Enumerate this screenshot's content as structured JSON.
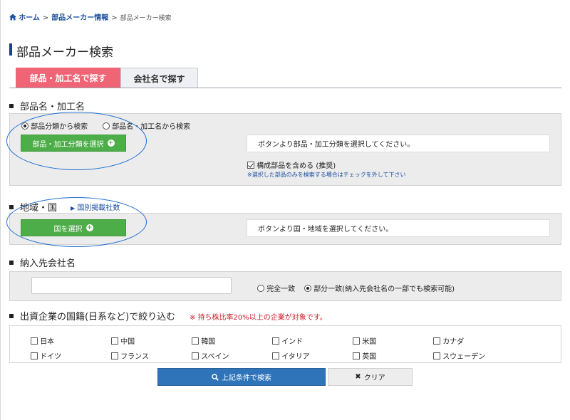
{
  "breadcrumb": {
    "home": "ホーム",
    "sep1": ">",
    "parts": "部品メーカー情報",
    "sep2": ">",
    "current": "部品メーカー検索"
  },
  "page_title": "部品メーカー検索",
  "tabs": [
    {
      "label": "部品・加工名で探す"
    },
    {
      "label": "会社名で探す"
    }
  ],
  "part_section": {
    "heading": "部品名・加工名",
    "radio_category": "部品分類から検索",
    "radio_name": "部品名・加工名から検索",
    "select_button": "部品・加工分類を選択",
    "info": "ボタンより部品・加工分類を選択してください。",
    "include_label": "構成部品を含める (推奨)",
    "include_note": "※選択した部品のみを検索する場合はチェックを外して下さい"
  },
  "region_section": {
    "heading": "地域・国",
    "link": "国別掲載社数",
    "select_button": "国を選択",
    "info": "ボタンより国・地域を選択してください。"
  },
  "customer_section": {
    "heading": "納入先会社名",
    "input_value": "",
    "radio_exact": "完全一致",
    "radio_partial": "部分一致(納入先会社名の一部でも検索可能)"
  },
  "nationality_section": {
    "heading": "出資企業の国籍(日系など)で絞り込む",
    "note": "※ 持ち株比率20%以上の企業が対象です。",
    "countries": [
      "日本",
      "中国",
      "韓国",
      "インド",
      "米国",
      "カナダ",
      "ドイツ",
      "フランス",
      "スペイン",
      "イタリア",
      "英国",
      "スウェーデン"
    ]
  },
  "actions": {
    "search": "上記条件で検索",
    "clear": "クリア"
  },
  "colors": {
    "accent_tab": "#f06575",
    "green_button": "#4dae49",
    "search_button": "#2f74b9",
    "link": "#1b4fa0",
    "annotation_circle": "#1f6fd0"
  }
}
